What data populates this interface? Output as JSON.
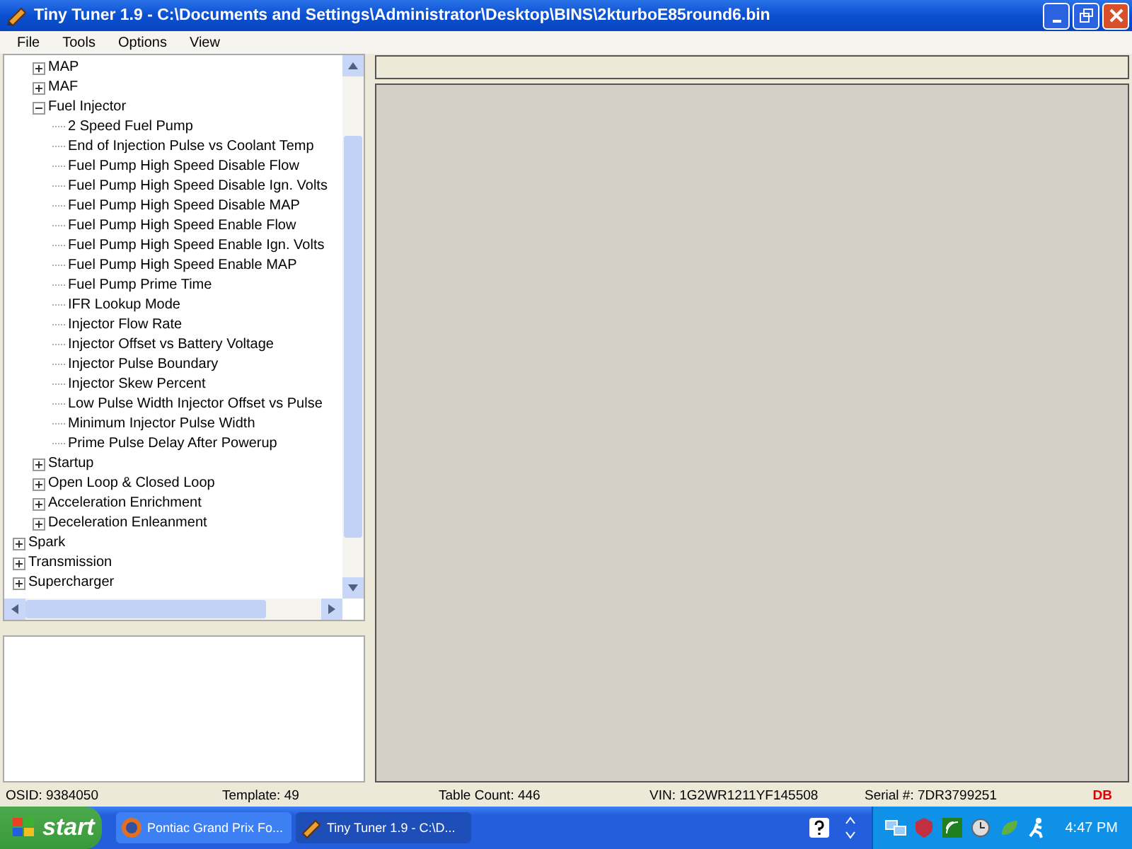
{
  "window": {
    "title": "Tiny Tuner 1.9 - C:\\Documents and Settings\\Administrator\\Desktop\\BINS\\2kturboE85round6.bin"
  },
  "menu": [
    "File",
    "Tools",
    "Options",
    "View"
  ],
  "tree": [
    {
      "children": [
        {
          "label": "MAP",
          "expanded": false
        },
        {
          "label": "MAF",
          "expanded": false
        },
        {
          "label": "Fuel Injector",
          "expanded": true,
          "children": [
            {
              "label": "2 Speed Fuel Pump"
            },
            {
              "label": "End of Injection Pulse vs Coolant Temp"
            },
            {
              "label": "Fuel Pump High Speed Disable Flow"
            },
            {
              "label": "Fuel Pump High Speed Disable Ign. Volts"
            },
            {
              "label": "Fuel Pump High Speed Disable MAP"
            },
            {
              "label": "Fuel Pump High Speed Enable Flow"
            },
            {
              "label": "Fuel Pump High Speed Enable Ign. Volts"
            },
            {
              "label": "Fuel Pump High Speed Enable MAP"
            },
            {
              "label": "Fuel Pump Prime Time"
            },
            {
              "label": "IFR Lookup Mode"
            },
            {
              "label": "Injector Flow Rate"
            },
            {
              "label": "Injector Offset vs Battery Voltage"
            },
            {
              "label": "Injector Pulse Boundary"
            },
            {
              "label": "Injector Skew Percent"
            },
            {
              "label": "Low Pulse Width Injector Offset vs Pulse"
            },
            {
              "label": "Minimum Injector Pulse Width"
            },
            {
              "label": "Prime Pulse Delay After Powerup"
            }
          ]
        },
        {
          "label": "Startup",
          "expanded": false
        },
        {
          "label": "Open Loop & Closed Loop",
          "expanded": false
        },
        {
          "label": "Acceleration Enrichment",
          "expanded": false
        },
        {
          "label": "Deceleration Enleanment",
          "expanded": false
        }
      ]
    },
    {
      "label": "Spark",
      "expanded": false
    },
    {
      "label": "Transmission",
      "expanded": false
    },
    {
      "label": "Supercharger",
      "expanded": false
    }
  ],
  "status_bar": [
    {
      "text": "OSID: 9384050"
    },
    {
      "text": "Template: 49"
    },
    {
      "text": "Table Count: 446"
    },
    {
      "text": "VIN: 1G2WR1211YF145508"
    },
    {
      "text": "Serial #: 7DR3799251"
    },
    {
      "text": "DB",
      "kind": "alert"
    }
  ],
  "taskbar": {
    "start": "start",
    "tasks": [
      {
        "label": "Pontiac Grand Prix Fo...",
        "kind": "browser",
        "selected": false
      },
      {
        "label": "Tiny Tuner 1.9 - C:\\D...",
        "kind": "tuner",
        "selected": true
      }
    ],
    "clock": "4:47 PM"
  }
}
